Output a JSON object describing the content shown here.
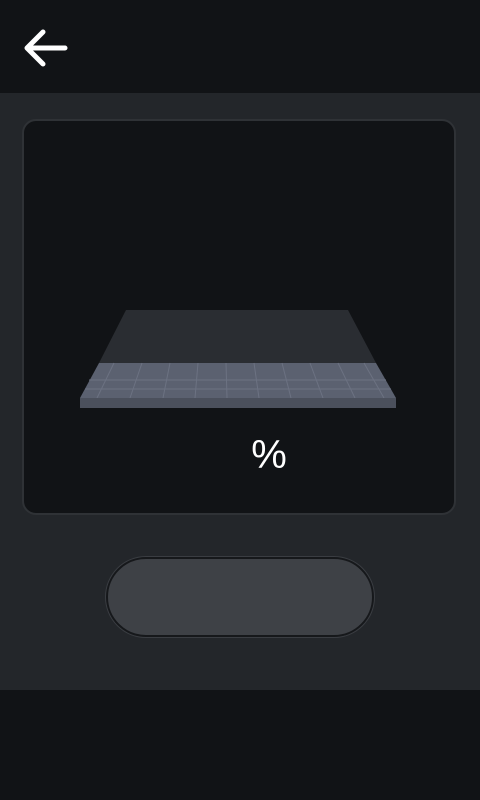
{
  "header": {
    "back_icon": "arrow-left-icon"
  },
  "monitor": {
    "plate_icon": "build-plate-icon",
    "percent_value": "",
    "percent_sign": "%"
  },
  "action": {
    "label": ""
  },
  "colors": {
    "background": "#111316",
    "content_bg": "#23262a",
    "panel_bg": "#111316",
    "plate_top": "#5b6170",
    "plate_back": "#2a2d32",
    "button_bg": "#3e4146",
    "text": "#ffffff"
  }
}
